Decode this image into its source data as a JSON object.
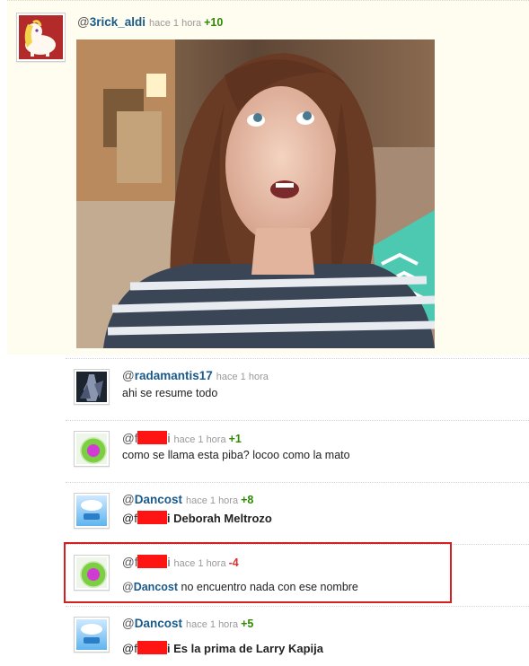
{
  "main_comment": {
    "username": "3rick_aldi",
    "time": "hace 1 hora",
    "score": "+10",
    "avatar_icon": "pony-avatar-icon",
    "image_icon": "photo-woman-looking-up"
  },
  "replies": [
    {
      "username": "radamantis17",
      "time": "hace 1 hora",
      "score": "",
      "text": "ahi se resume todo",
      "avatar_icon": "dark-figure-avatar-icon"
    },
    {
      "username_prefix": "f",
      "username_suffix": "i",
      "time": "hace 1 hora",
      "score": "+1",
      "text": "como se llama esta piba? locoo como la mato",
      "avatar_icon": "green-ring-avatar-icon"
    },
    {
      "username": "Dancost",
      "time": "hace 1 hora",
      "score": "+8",
      "mention_prefix": "f",
      "mention_suffix": "i",
      "text": "Deborah Meltrozo",
      "avatar_icon": "cloud-avatar-icon"
    },
    {
      "username_prefix": "f",
      "username_suffix": "i",
      "time": "hace 1 hora",
      "score": "-4",
      "mention": "Dancost",
      "text": "no encuentro nada con ese nombre",
      "avatar_icon": "green-ring-avatar-icon"
    },
    {
      "username": "Dancost",
      "time": "hace 1 hora",
      "score": "+5",
      "mention_prefix": "f",
      "mention_suffix": "i",
      "text": "Es la prima de Larry Kapija",
      "avatar_icon": "cloud-avatar-icon"
    }
  ],
  "colors": {
    "username": "#1a5a8a",
    "positive_score": "#2e8b00",
    "negative_score": "#e03030",
    "redaction": "#ff1414",
    "highlight_border": "#d62020",
    "main_background": "#fffdf0"
  }
}
